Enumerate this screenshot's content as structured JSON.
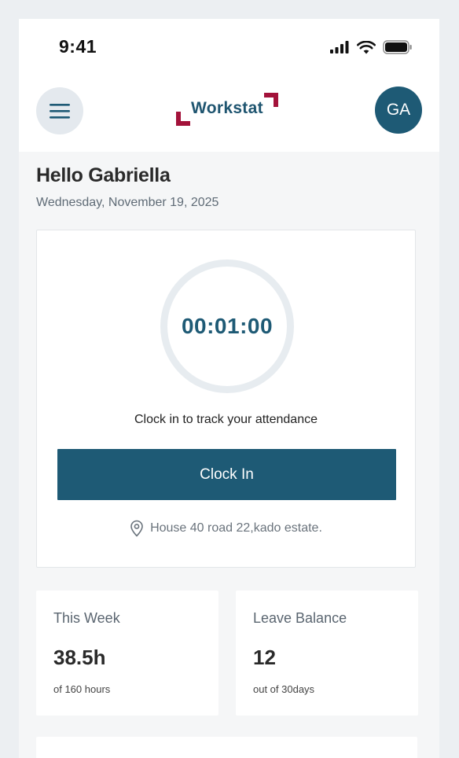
{
  "status_bar": {
    "time": "9:41"
  },
  "header": {
    "logo_text": "Workstat",
    "avatar_initials": "GA"
  },
  "greeting": {
    "title": "Hello Gabriella",
    "date": "Wednesday, November 19, 2025"
  },
  "clock_card": {
    "timer": "00:01:00",
    "hint": "Clock in to track your attendance",
    "button_label": "Clock In",
    "location": "House 40 road 22,kado estate."
  },
  "stats": [
    {
      "label": "This Week",
      "value": "38.5h",
      "sub": "of 160 hours"
    },
    {
      "label": "Leave Balance",
      "value": "12",
      "sub": "out of 30days"
    }
  ],
  "colors": {
    "primary": "#1e5a75",
    "brand_accent": "#a3123a",
    "background": "#f5f6f7"
  }
}
